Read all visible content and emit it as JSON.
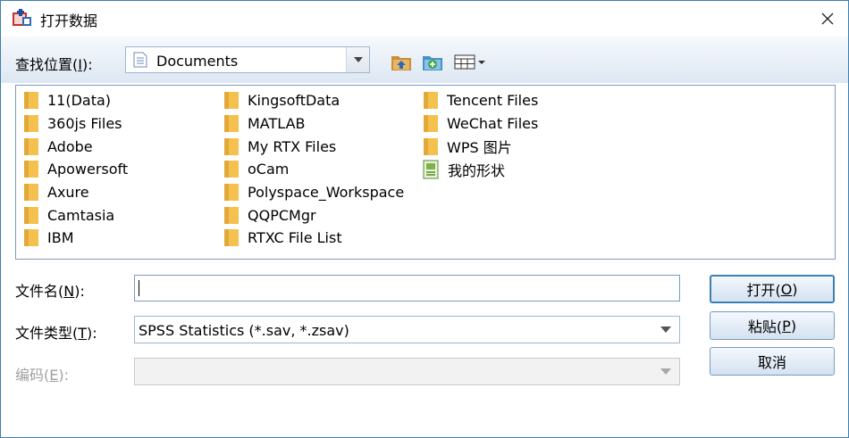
{
  "window": {
    "title": "打开数据"
  },
  "toolbar": {
    "lookin_label_pre": "查找位置(",
    "lookin_label_key": "I",
    "lookin_label_post": "):",
    "lookin_value": "Documents"
  },
  "files": {
    "col1": [
      "11(Data)",
      "360js Files",
      "Adobe",
      "Apowersoft",
      "Axure",
      "Camtasia",
      "IBM"
    ],
    "col2": [
      "KingsoftData",
      "MATLAB",
      "My RTX Files",
      "oCam",
      "Polyspace_Workspace",
      "QQPCMgr",
      "RTXC File List"
    ],
    "col3": [
      "Tencent Files",
      "WeChat Files",
      "WPS 图片"
    ],
    "special_item": "我的形状"
  },
  "form": {
    "filename_pre": "文件名(",
    "filename_key": "N",
    "filename_post": "):",
    "filename_value": "",
    "filetype_pre": "文件类型(",
    "filetype_key": "T",
    "filetype_post": "):",
    "filetype_value": "SPSS Statistics (*.sav, *.zsav)",
    "encoding_pre": "编码(",
    "encoding_key": "E",
    "encoding_post": "):",
    "encoding_value": ""
  },
  "buttons": {
    "open_pre": "打开(",
    "open_key": "O",
    "open_post": ")",
    "paste_pre": "粘贴(",
    "paste_key": "P",
    "paste_post": ")",
    "cancel": "取消"
  },
  "colors": {
    "accent": "#3c7fb1",
    "folder": "#f5c14e",
    "disabled_text": "#a0a0a0"
  },
  "icons": [
    "app-icon",
    "close-icon",
    "document-icon",
    "chevron-down-icon",
    "up-folder-icon",
    "new-folder-icon",
    "view-menu-icon",
    "folder-icon",
    "shapes-icon"
  ]
}
